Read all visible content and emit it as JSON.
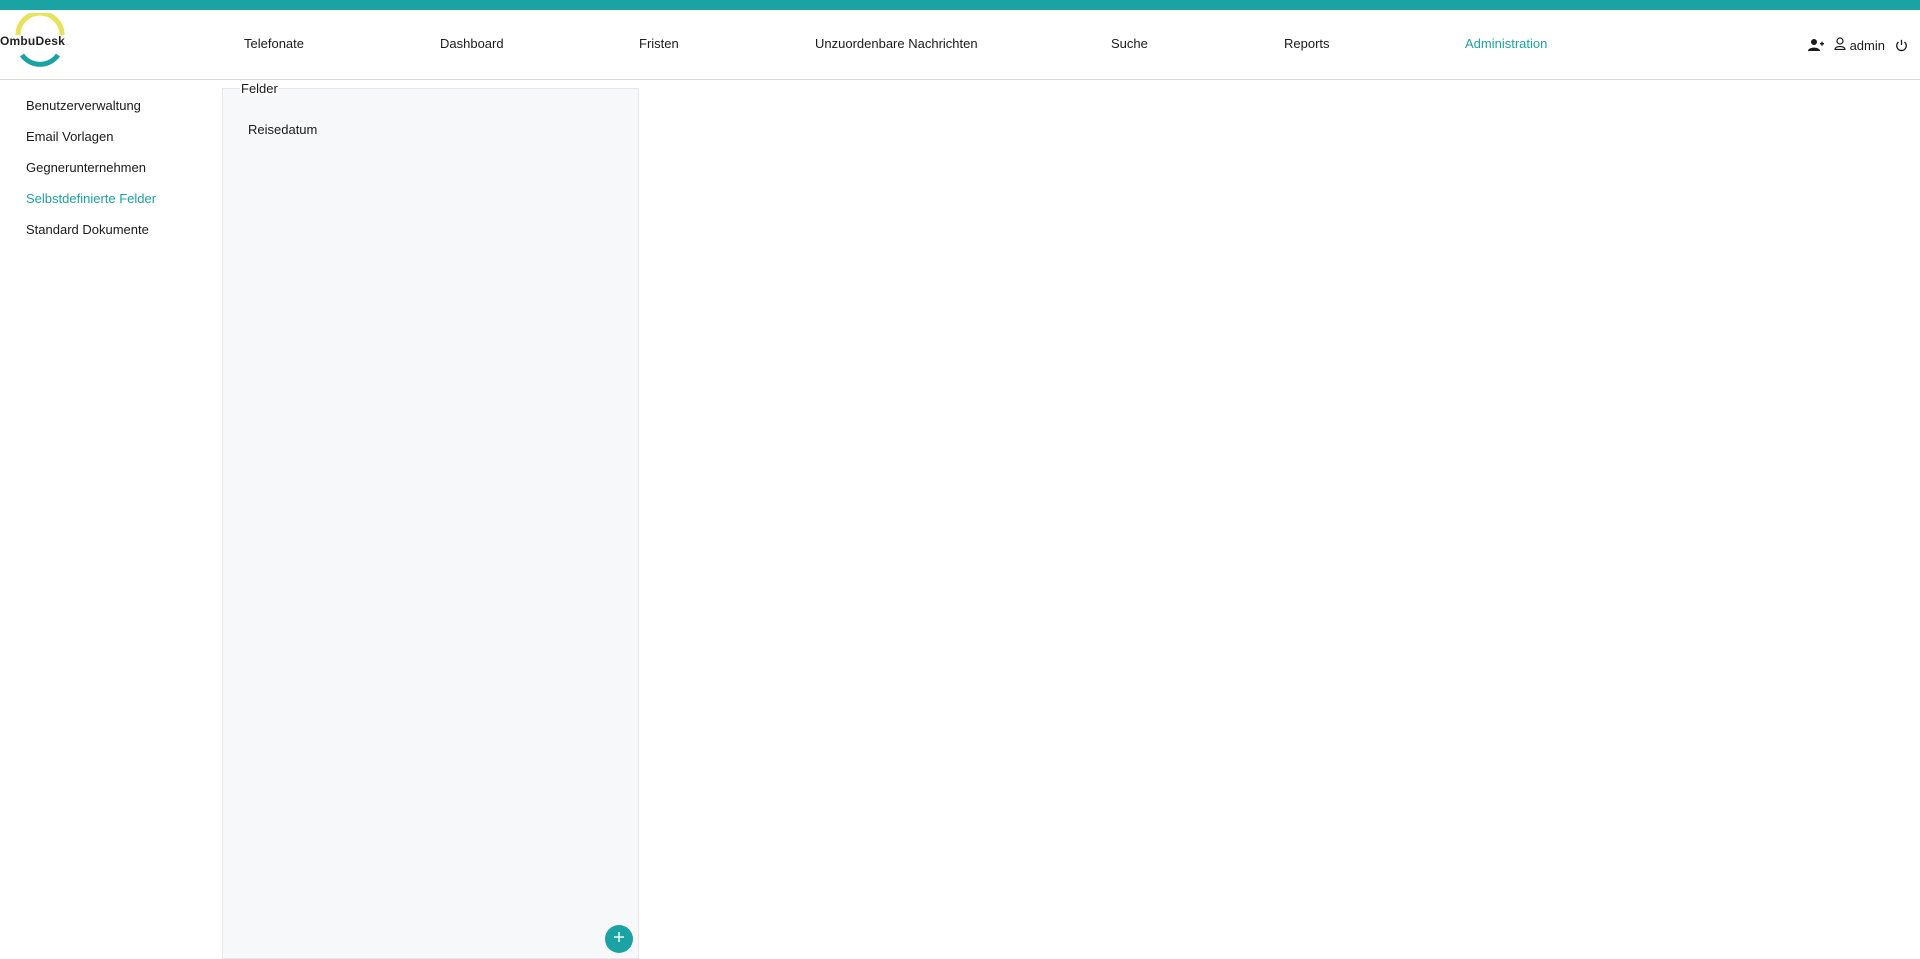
{
  "app": {
    "logo_text": "OmbuDesk",
    "accent_color": "#1ba3a3",
    "logo_colors": [
      "#e8e25a",
      "#1ba3a3"
    ]
  },
  "nav": {
    "items": [
      {
        "label": "Telefonate"
      },
      {
        "label": "Dashboard"
      },
      {
        "label": "Fristen"
      },
      {
        "label": "Unzuordenbare Nachrichten"
      },
      {
        "label": "Suche"
      },
      {
        "label": "Reports"
      },
      {
        "label": "Administration",
        "active": true
      }
    ]
  },
  "header_right": {
    "add_user_icon": "user-plus-icon",
    "user_icon": "user-icon",
    "username": "admin",
    "logout_icon": "power-icon"
  },
  "sidebar": {
    "items": [
      {
        "label": "Benutzerverwaltung"
      },
      {
        "label": "Email Vorlagen"
      },
      {
        "label": "Gegnerunternehmen"
      },
      {
        "label": "Selbstdefinierte Felder",
        "active": true
      },
      {
        "label": "Standard Dokumente"
      }
    ]
  },
  "panel": {
    "title": "Felder",
    "items": [
      {
        "label": "Reisedatum"
      }
    ],
    "add_icon": "plus-icon"
  }
}
